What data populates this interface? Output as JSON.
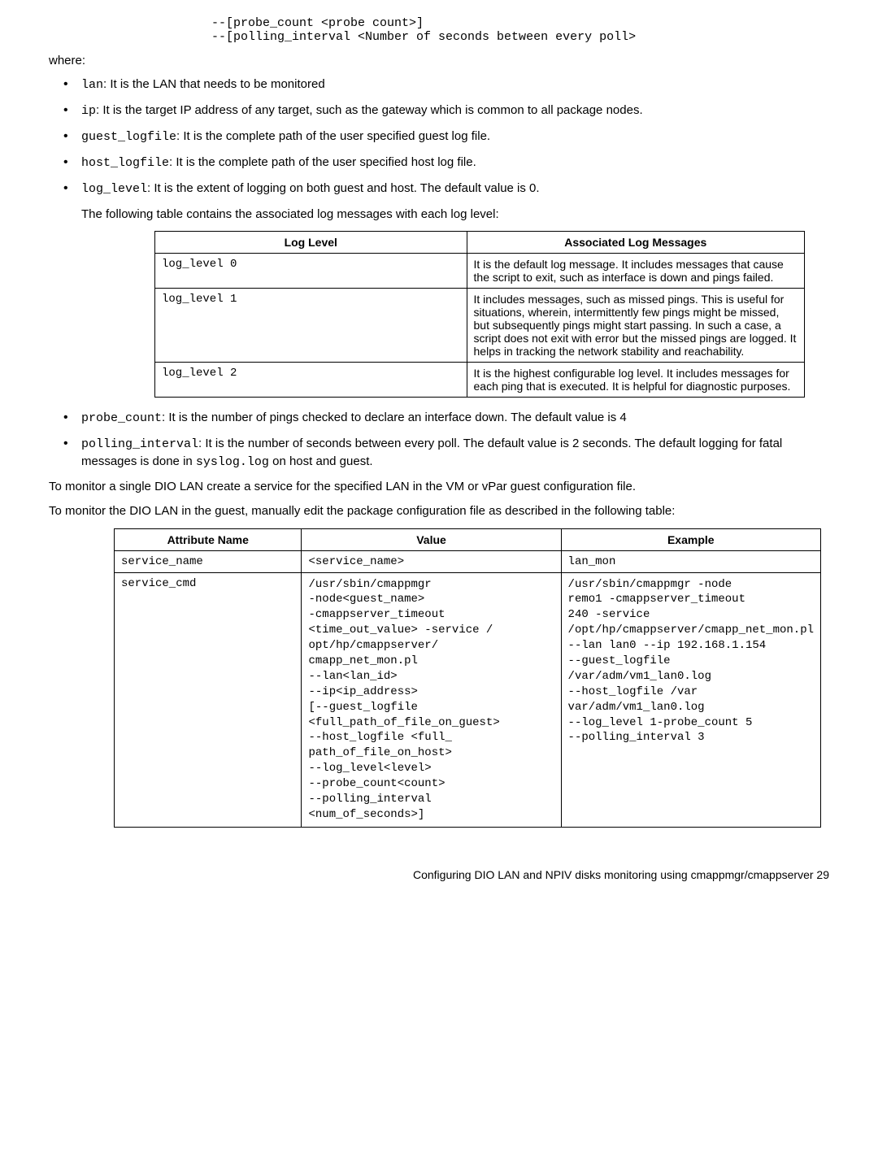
{
  "codeHeader": "--[probe_count <probe count>]\n--[polling_interval <Number of seconds between every poll>",
  "where": "where:",
  "bullets1": [
    {
      "code": "lan",
      "rest": ": It is the LAN that needs to be monitored"
    },
    {
      "code": "ip",
      "rest": ": It is the target IP address of any target, such as the gateway which is common to all package nodes."
    },
    {
      "code": "guest_logfile",
      "rest": ": It is the complete path of the user specified guest log file."
    },
    {
      "code": "host_logfile",
      "rest": ": It is the complete path of the user specified host log file."
    },
    {
      "code": "log_level",
      "rest": ": It is the extent of logging on both guest and host. The default value is 0."
    }
  ],
  "tableIntro": "The following table contains the associated log messages with each log level:",
  "logTable": {
    "headers": [
      "Log Level",
      "Associated Log Messages"
    ],
    "rows": [
      [
        "log_level 0",
        "It is the default log message. It includes messages that cause the script to exit, such as interface is down and pings failed."
      ],
      [
        "log_level 1",
        "It includes messages, such as missed pings. This is useful for situations, wherein, intermittently few pings might be missed, but subsequently pings might start passing. In such a case, a script does not exit with error but the missed pings are logged. It helps in tracking the network stability and reachability."
      ],
      [
        "log_level 2",
        "It is the highest configurable log level. It includes messages for each ping that is executed. It is helpful for diagnostic purposes."
      ]
    ]
  },
  "bullets2": [
    {
      "code": "probe_count",
      "rest": ": It is the number of pings checked to declare an interface down. The default value is 4"
    },
    {
      "code": "polling_interval",
      "preText": ": It is the number of seconds between every poll. The default value is 2 seconds. The default logging for fatal messages is done in ",
      "code2": "syslog.log",
      "postText": " on host and guest."
    }
  ],
  "para1": "To monitor a single DIO LAN create a service for the specified LAN in the VM or vPar guest configuration file.",
  "para2": "To monitor the DIO LAN in the guest, manually edit the package configuration file as described in the following table:",
  "attribTable": {
    "headers": [
      "Attribute Name",
      "Value",
      "Example"
    ],
    "rows": [
      {
        "name": "service_name",
        "value": "<service_name>",
        "example": "lan_mon"
      },
      {
        "name": "service_cmd",
        "value": "/usr/sbin/cmappmgr\n-node<guest_name>\n-cmappserver_timeout\n<time_out_value> -service /\nopt/hp/cmappserver/\ncmapp_net_mon.pl\n--lan<lan_id>\n--ip<ip_address>\n[--guest_logfile\n<full_path_of_file_on_guest>\n--host_logfile <full_\npath_of_file_on_host>\n--log_level<level>\n--probe_count<count>\n--polling_interval\n<num_of_seconds>]",
        "example": "/usr/sbin/cmappmgr -node\nremo1 -cmappserver_timeout\n240 -service\n/opt/hp/cmappserver/cmapp_net_mon.pl\n--lan lan0 --ip 192.168.1.154\n--guest_logfile\n/var/adm/vm1_lan0.log\n--host_logfile /var\nvar/adm/vm1_lan0.log\n--log_level 1-probe_count 5\n--polling_interval 3"
      }
    ]
  },
  "footer": "Configuring DIO LAN and NPIV disks monitoring using cmappmgr/cmappserver    29"
}
